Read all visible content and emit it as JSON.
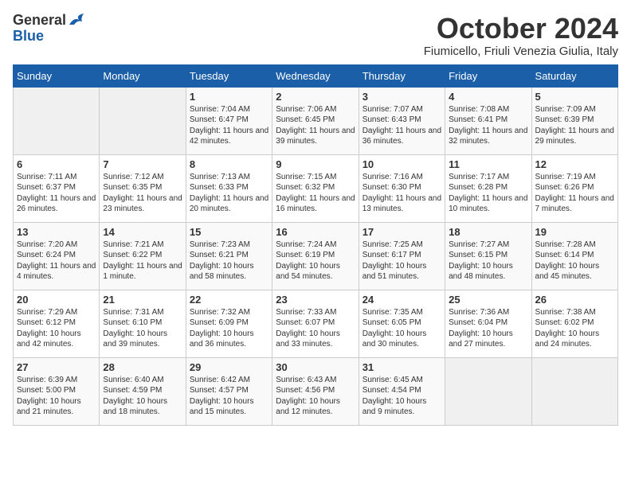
{
  "header": {
    "logo_general": "General",
    "logo_blue": "Blue",
    "month_title": "October 2024",
    "location": "Fiumicello, Friuli Venezia Giulia, Italy"
  },
  "weekdays": [
    "Sunday",
    "Monday",
    "Tuesday",
    "Wednesday",
    "Thursday",
    "Friday",
    "Saturday"
  ],
  "weeks": [
    [
      {
        "day": "",
        "empty": true
      },
      {
        "day": "",
        "empty": true
      },
      {
        "day": "1",
        "sunrise": "Sunrise: 7:04 AM",
        "sunset": "Sunset: 6:47 PM",
        "daylight": "Daylight: 11 hours and 42 minutes."
      },
      {
        "day": "2",
        "sunrise": "Sunrise: 7:06 AM",
        "sunset": "Sunset: 6:45 PM",
        "daylight": "Daylight: 11 hours and 39 minutes."
      },
      {
        "day": "3",
        "sunrise": "Sunrise: 7:07 AM",
        "sunset": "Sunset: 6:43 PM",
        "daylight": "Daylight: 11 hours and 36 minutes."
      },
      {
        "day": "4",
        "sunrise": "Sunrise: 7:08 AM",
        "sunset": "Sunset: 6:41 PM",
        "daylight": "Daylight: 11 hours and 32 minutes."
      },
      {
        "day": "5",
        "sunrise": "Sunrise: 7:09 AM",
        "sunset": "Sunset: 6:39 PM",
        "daylight": "Daylight: 11 hours and 29 minutes."
      }
    ],
    [
      {
        "day": "6",
        "sunrise": "Sunrise: 7:11 AM",
        "sunset": "Sunset: 6:37 PM",
        "daylight": "Daylight: 11 hours and 26 minutes."
      },
      {
        "day": "7",
        "sunrise": "Sunrise: 7:12 AM",
        "sunset": "Sunset: 6:35 PM",
        "daylight": "Daylight: 11 hours and 23 minutes."
      },
      {
        "day": "8",
        "sunrise": "Sunrise: 7:13 AM",
        "sunset": "Sunset: 6:33 PM",
        "daylight": "Daylight: 11 hours and 20 minutes."
      },
      {
        "day": "9",
        "sunrise": "Sunrise: 7:15 AM",
        "sunset": "Sunset: 6:32 PM",
        "daylight": "Daylight: 11 hours and 16 minutes."
      },
      {
        "day": "10",
        "sunrise": "Sunrise: 7:16 AM",
        "sunset": "Sunset: 6:30 PM",
        "daylight": "Daylight: 11 hours and 13 minutes."
      },
      {
        "day": "11",
        "sunrise": "Sunrise: 7:17 AM",
        "sunset": "Sunset: 6:28 PM",
        "daylight": "Daylight: 11 hours and 10 minutes."
      },
      {
        "day": "12",
        "sunrise": "Sunrise: 7:19 AM",
        "sunset": "Sunset: 6:26 PM",
        "daylight": "Daylight: 11 hours and 7 minutes."
      }
    ],
    [
      {
        "day": "13",
        "sunrise": "Sunrise: 7:20 AM",
        "sunset": "Sunset: 6:24 PM",
        "daylight": "Daylight: 11 hours and 4 minutes."
      },
      {
        "day": "14",
        "sunrise": "Sunrise: 7:21 AM",
        "sunset": "Sunset: 6:22 PM",
        "daylight": "Daylight: 11 hours and 1 minute."
      },
      {
        "day": "15",
        "sunrise": "Sunrise: 7:23 AM",
        "sunset": "Sunset: 6:21 PM",
        "daylight": "Daylight: 10 hours and 58 minutes."
      },
      {
        "day": "16",
        "sunrise": "Sunrise: 7:24 AM",
        "sunset": "Sunset: 6:19 PM",
        "daylight": "Daylight: 10 hours and 54 minutes."
      },
      {
        "day": "17",
        "sunrise": "Sunrise: 7:25 AM",
        "sunset": "Sunset: 6:17 PM",
        "daylight": "Daylight: 10 hours and 51 minutes."
      },
      {
        "day": "18",
        "sunrise": "Sunrise: 7:27 AM",
        "sunset": "Sunset: 6:15 PM",
        "daylight": "Daylight: 10 hours and 48 minutes."
      },
      {
        "day": "19",
        "sunrise": "Sunrise: 7:28 AM",
        "sunset": "Sunset: 6:14 PM",
        "daylight": "Daylight: 10 hours and 45 minutes."
      }
    ],
    [
      {
        "day": "20",
        "sunrise": "Sunrise: 7:29 AM",
        "sunset": "Sunset: 6:12 PM",
        "daylight": "Daylight: 10 hours and 42 minutes."
      },
      {
        "day": "21",
        "sunrise": "Sunrise: 7:31 AM",
        "sunset": "Sunset: 6:10 PM",
        "daylight": "Daylight: 10 hours and 39 minutes."
      },
      {
        "day": "22",
        "sunrise": "Sunrise: 7:32 AM",
        "sunset": "Sunset: 6:09 PM",
        "daylight": "Daylight: 10 hours and 36 minutes."
      },
      {
        "day": "23",
        "sunrise": "Sunrise: 7:33 AM",
        "sunset": "Sunset: 6:07 PM",
        "daylight": "Daylight: 10 hours and 33 minutes."
      },
      {
        "day": "24",
        "sunrise": "Sunrise: 7:35 AM",
        "sunset": "Sunset: 6:05 PM",
        "daylight": "Daylight: 10 hours and 30 minutes."
      },
      {
        "day": "25",
        "sunrise": "Sunrise: 7:36 AM",
        "sunset": "Sunset: 6:04 PM",
        "daylight": "Daylight: 10 hours and 27 minutes."
      },
      {
        "day": "26",
        "sunrise": "Sunrise: 7:38 AM",
        "sunset": "Sunset: 6:02 PM",
        "daylight": "Daylight: 10 hours and 24 minutes."
      }
    ],
    [
      {
        "day": "27",
        "sunrise": "Sunrise: 6:39 AM",
        "sunset": "Sunset: 5:00 PM",
        "daylight": "Daylight: 10 hours and 21 minutes."
      },
      {
        "day": "28",
        "sunrise": "Sunrise: 6:40 AM",
        "sunset": "Sunset: 4:59 PM",
        "daylight": "Daylight: 10 hours and 18 minutes."
      },
      {
        "day": "29",
        "sunrise": "Sunrise: 6:42 AM",
        "sunset": "Sunset: 4:57 PM",
        "daylight": "Daylight: 10 hours and 15 minutes."
      },
      {
        "day": "30",
        "sunrise": "Sunrise: 6:43 AM",
        "sunset": "Sunset: 4:56 PM",
        "daylight": "Daylight: 10 hours and 12 minutes."
      },
      {
        "day": "31",
        "sunrise": "Sunrise: 6:45 AM",
        "sunset": "Sunset: 4:54 PM",
        "daylight": "Daylight: 10 hours and 9 minutes."
      },
      {
        "day": "",
        "empty": true
      },
      {
        "day": "",
        "empty": true
      }
    ]
  ]
}
